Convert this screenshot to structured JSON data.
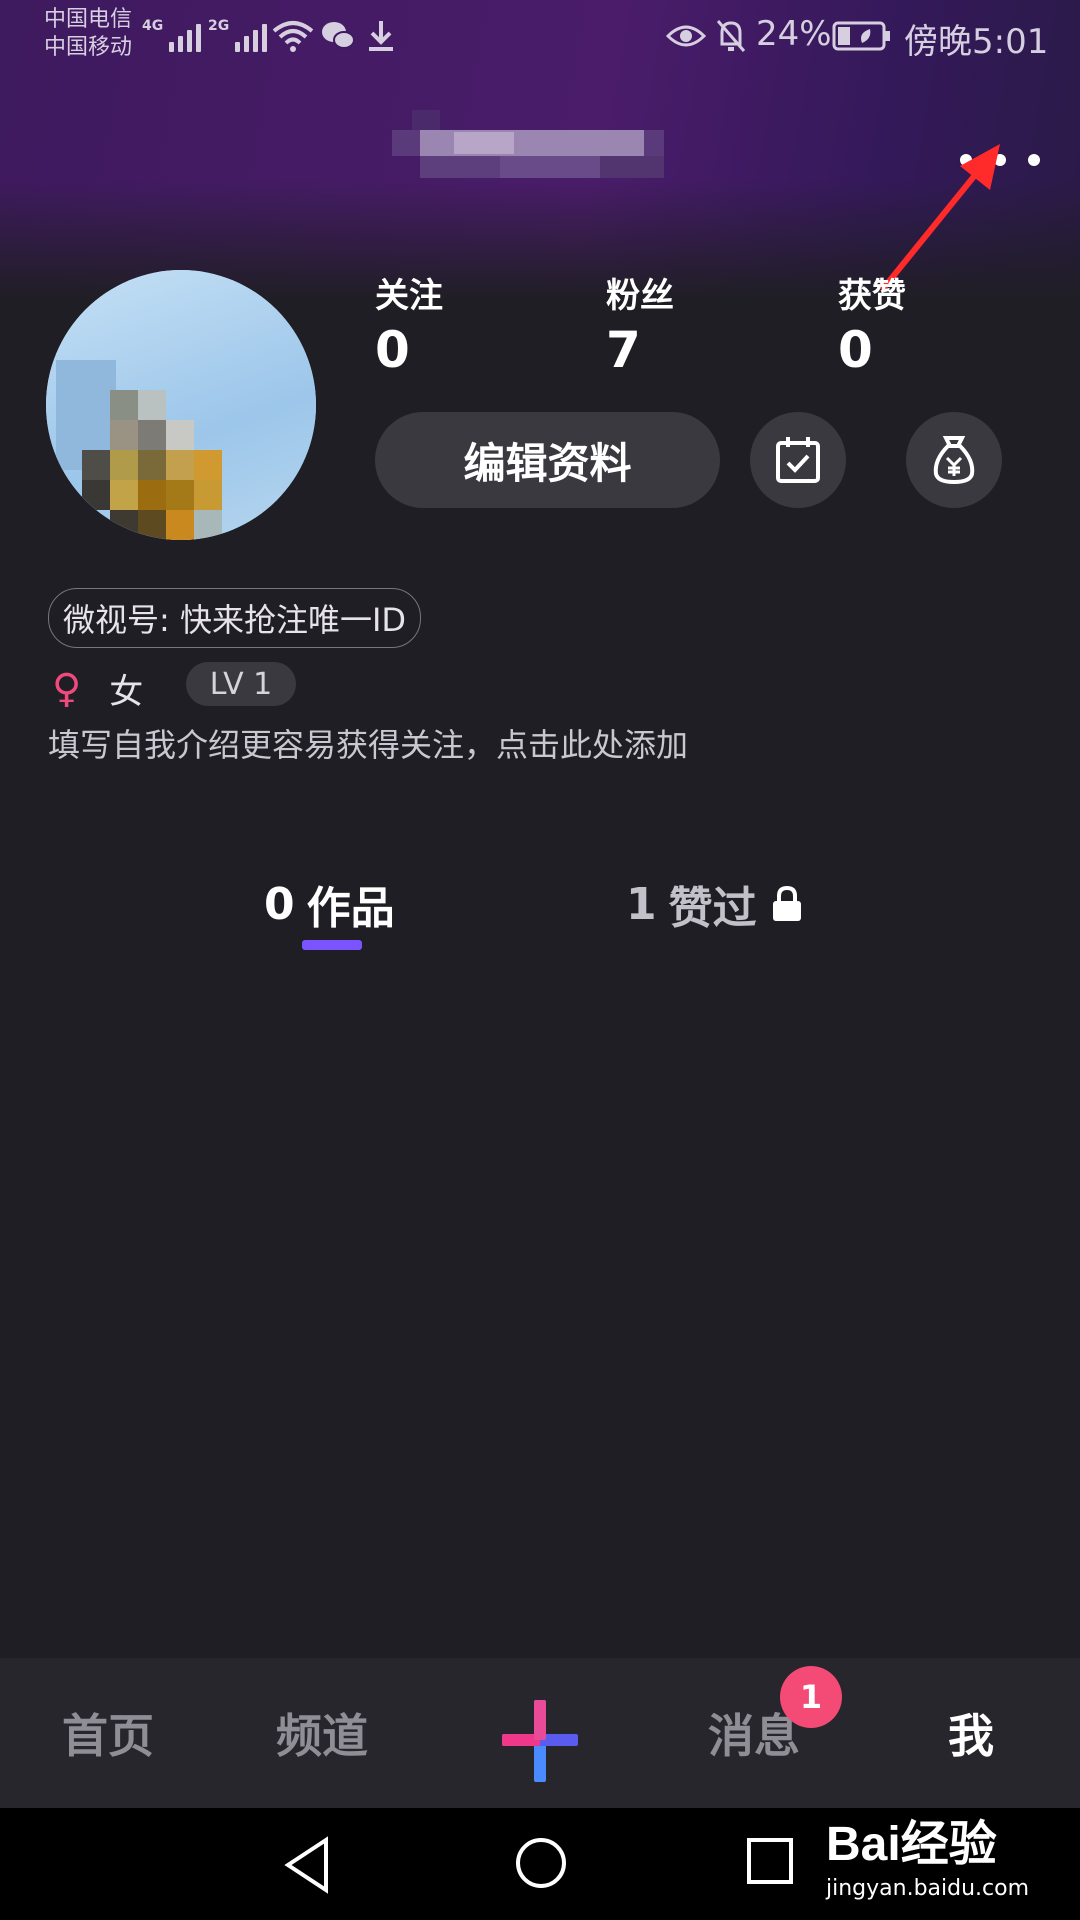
{
  "status_bar": {
    "carrier_1": "中国电信",
    "carrier_2": "中国移动",
    "signal_1_gen": "4G",
    "signal_2_gen": "2G",
    "battery": "24%",
    "time": "傍晚5:01"
  },
  "profile": {
    "stats": [
      {
        "label": "关注",
        "value": "0"
      },
      {
        "label": "粉丝",
        "value": "7"
      },
      {
        "label": "获赞",
        "value": "0"
      }
    ],
    "edit_button": "编辑资料",
    "weishi_id": "微视号: 快来抢注唯一ID",
    "gender": "女",
    "gender_symbol": "♀",
    "level": "LV 1",
    "bio_placeholder": "填写自我介绍更容易获得关注，点击此处添加"
  },
  "tabs": [
    {
      "count": "0",
      "label": "作品",
      "active": true
    },
    {
      "count": "1",
      "label": "赞过",
      "locked": true
    }
  ],
  "bottom_nav": {
    "items": [
      "首页",
      "频道",
      "消息",
      "我"
    ],
    "messages_badge": "1",
    "active": "我"
  },
  "watermark": {
    "brand": "Bai经验",
    "url": "jingyan.baidu.com"
  },
  "colors": {
    "accent": "#7a54ff",
    "badge": "#f44a76",
    "background": "#1f1e24",
    "button": "#3a393f"
  }
}
